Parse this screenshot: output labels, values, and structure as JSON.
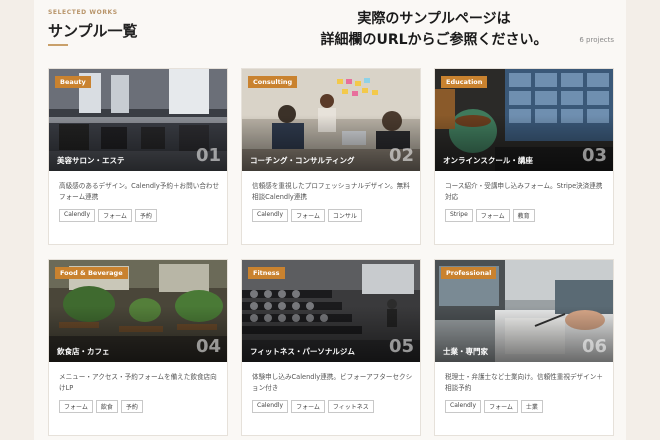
{
  "header": {
    "eyebrow": "SELECTED WORKS",
    "title": "サンプル一覧",
    "overlay_line1": "実際のサンプルページは",
    "overlay_line2": "詳細欄のURLからご参照ください。",
    "count": "6 projects"
  },
  "cards": [
    {
      "badge": "Beauty",
      "category": "美容サロン・エステ",
      "number": "01",
      "desc": "高級感のあるデザイン。Calendly予約＋お問い合わせフォーム連携",
      "tags": [
        "Calendly",
        "フォーム",
        "予約"
      ]
    },
    {
      "badge": "Consulting",
      "category": "コーチング・コンサルティング",
      "number": "02",
      "desc": "信頼感を重視したプロフェッショナルデザイン。無料相談Calendly連携",
      "tags": [
        "Calendly",
        "フォーム",
        "コンサル"
      ]
    },
    {
      "badge": "Education",
      "category": "オンラインスクール・講座",
      "number": "03",
      "desc": "コース紹介・受講申し込みフォーム。Stripe決済連携対応",
      "tags": [
        "Stripe",
        "フォーム",
        "教育"
      ]
    },
    {
      "badge": "Food & Beverage",
      "category": "飲食店・カフェ",
      "number": "04",
      "desc": "メニュー・アクセス・予約フォームを備えた飲食店向けLP",
      "tags": [
        "フォーム",
        "飲食",
        "予約"
      ]
    },
    {
      "badge": "Fitness",
      "category": "フィットネス・パーソナルジム",
      "number": "05",
      "desc": "体験申し込みCalendly連携。ビフォーアフターセクション付き",
      "tags": [
        "Calendly",
        "フォーム",
        "フィットネス"
      ]
    },
    {
      "badge": "Professional",
      "category": "士業・専門家",
      "number": "06",
      "desc": "税理士・弁護士など士業向け。信頼性重視デザイン＋相談予約",
      "tags": [
        "Calendly",
        "フォーム",
        "士業"
      ]
    }
  ]
}
